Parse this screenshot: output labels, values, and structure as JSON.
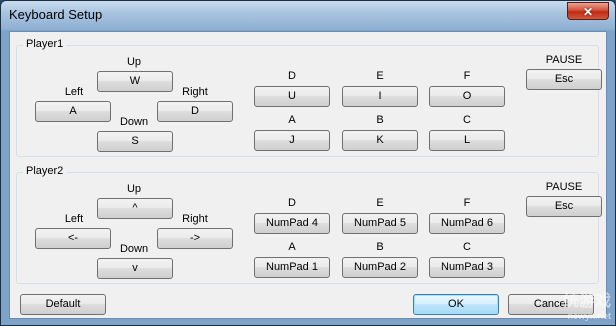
{
  "window": {
    "title": "Keyboard Setup",
    "close_glyph": "✕"
  },
  "player1": {
    "group_label": "Player1",
    "labels": {
      "up": "Up",
      "left": "Left",
      "right": "Right",
      "down": "Down",
      "d": "D",
      "e": "E",
      "f": "F",
      "a": "A",
      "b": "B",
      "c": "C",
      "pause": "PAUSE"
    },
    "keys": {
      "up": "W",
      "left": "A",
      "right": "D",
      "down": "S",
      "d": "U",
      "e": "I",
      "f": "O",
      "a": "J",
      "b": "K",
      "c": "L",
      "pause": "Esc"
    }
  },
  "player2": {
    "group_label": "Player2",
    "labels": {
      "up": "Up",
      "left": "Left",
      "right": "Right",
      "down": "Down",
      "d": "D",
      "e": "E",
      "f": "F",
      "a": "A",
      "b": "B",
      "c": "C",
      "pause": "PAUSE"
    },
    "keys": {
      "up": "^",
      "left": "<-",
      "right": "->",
      "down": "v",
      "d": "NumPad 4",
      "e": "NumPad 5",
      "f": "NumPad 6",
      "a": "NumPad 1",
      "b": "NumPad 2",
      "c": "NumPad 3",
      "pause": "Esc"
    }
  },
  "footer": {
    "default_label": "Default",
    "ok_label": "OK",
    "cancel_label": "Cancel"
  },
  "watermark": {
    "main": "统游戏",
    "sub": "newyx.net"
  }
}
